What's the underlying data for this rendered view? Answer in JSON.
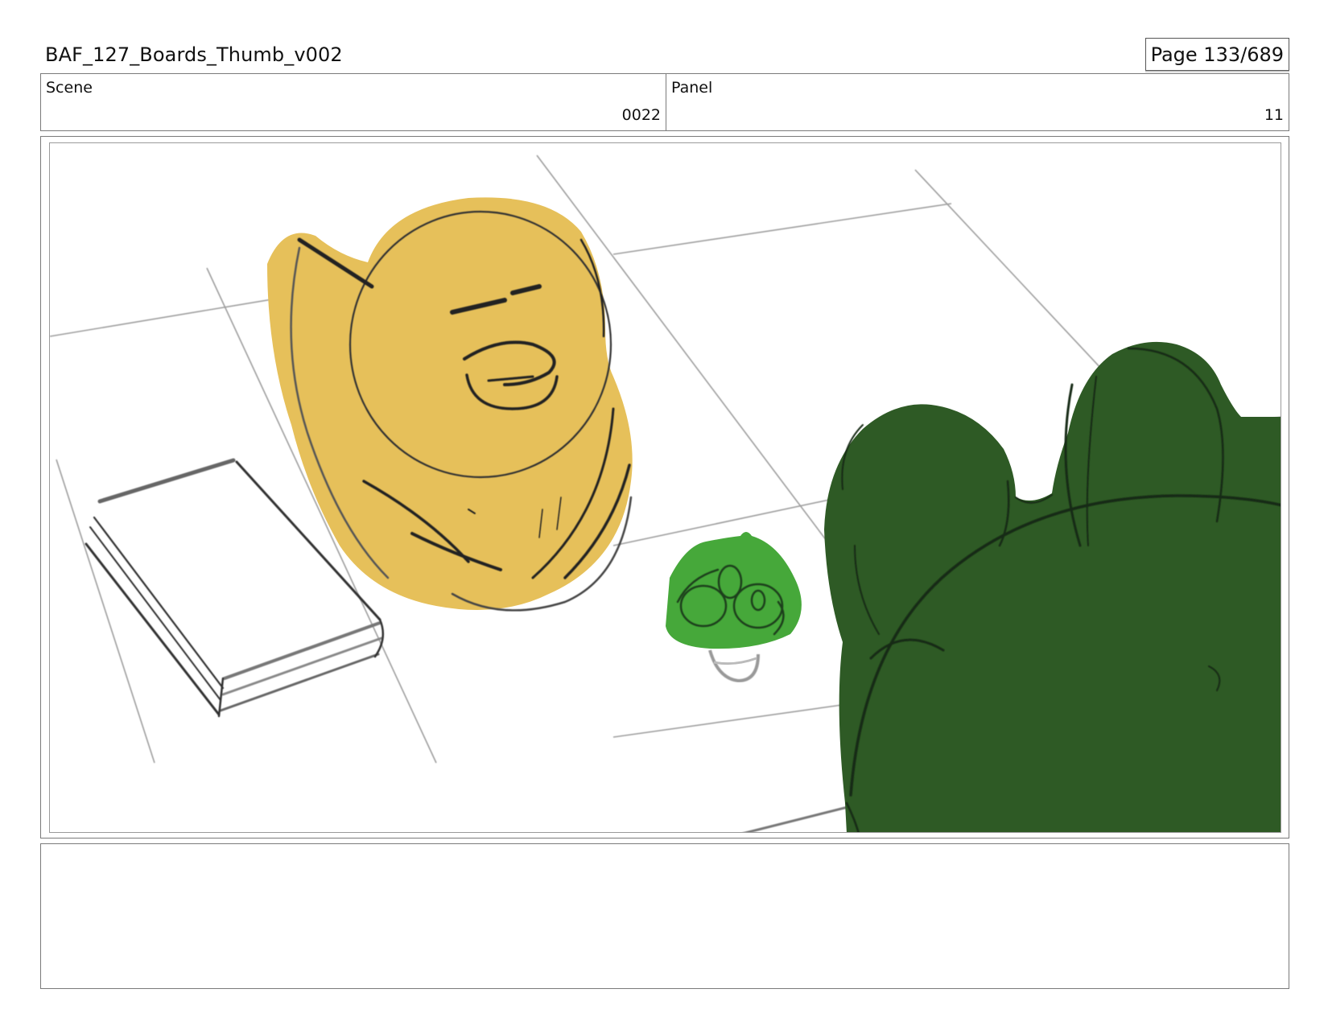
{
  "header": {
    "title": "BAF_127_Boards_Thumb_v002",
    "page_label": "Page 133/689"
  },
  "info": {
    "scene_label": "Scene",
    "scene_value": "0022",
    "panel_label": "Panel",
    "panel_value": "11"
  },
  "drawing": {
    "subjects": [
      "yellow-duck-icon",
      "small-green-frog-icon",
      "large-green-frog-icon",
      "book-icon"
    ],
    "colors": {
      "duck": "#e6c05a",
      "frog_small": "#46a83a",
      "frog_large": "#2e5a25",
      "line": "#222222"
    }
  },
  "notes": {
    "text": ""
  }
}
